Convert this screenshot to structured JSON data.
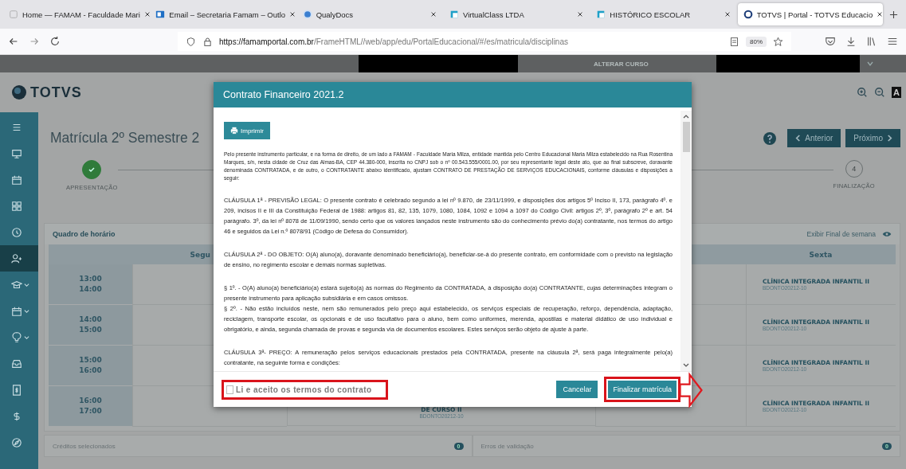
{
  "browser": {
    "tabs": [
      {
        "title": "Home — FAMAM - Faculdade Mari",
        "kind": "page",
        "selected": false
      },
      {
        "title": "Email – Secretaria Famam – Outlo",
        "kind": "mail",
        "selected": false
      },
      {
        "title": "QualyDocs",
        "kind": "globe",
        "selected": false
      },
      {
        "title": "VirtualClass LTDA",
        "kind": "square",
        "selected": false
      },
      {
        "title": "HISTÓRICO ESCOLAR",
        "kind": "square",
        "selected": false
      },
      {
        "title": "TOTVS | Portal - TOTVS Educacio",
        "kind": "ring",
        "selected": true
      }
    ],
    "url_host": "https://famamportal.com.br",
    "url_path": "/FrameHTML//web/app/edu/PortalEducacional/#/es/matricula/disciplinas",
    "zoom": "80%"
  },
  "top_bar": {
    "link": "ALTERAR CURSO"
  },
  "brand": {
    "logo": "TOTVS",
    "font_button": "A"
  },
  "sidebar": {
    "items": [
      {
        "kind": "menu",
        "selected": false,
        "expandable": false
      },
      {
        "kind": "monitor",
        "selected": false,
        "expandable": false
      },
      {
        "kind": "calendar",
        "selected": false,
        "expandable": false
      },
      {
        "kind": "grid",
        "selected": false,
        "expandable": false
      },
      {
        "kind": "clock",
        "selected": false,
        "expandable": false
      },
      {
        "kind": "person-add",
        "selected": true,
        "expandable": false
      },
      {
        "kind": "cap",
        "selected": false,
        "expandable": true
      },
      {
        "kind": "calendar",
        "selected": false,
        "expandable": true
      },
      {
        "kind": "bulb",
        "selected": false,
        "expandable": true
      },
      {
        "kind": "inbox",
        "selected": false,
        "expandable": false
      },
      {
        "kind": "document",
        "selected": false,
        "expandable": false
      },
      {
        "kind": "dollar",
        "selected": false,
        "expandable": false
      },
      {
        "kind": "compass",
        "selected": false,
        "expandable": false
      }
    ]
  },
  "page": {
    "title": "Matrícula 2º Semestre 2",
    "buttons": [
      {
        "label": "Anterior",
        "kind": "prev"
      },
      {
        "label": "Próximo",
        "kind": "next"
      }
    ]
  },
  "stepper": {
    "steps": [
      {
        "label": "APRESENTAÇÃO",
        "done": true
      },
      {
        "marker": "4",
        "label": "FINALIZAÇÃO",
        "done": false
      }
    ]
  },
  "schedule": {
    "title": "Quadro de horário",
    "weekend_toggle": "Exibir Final de semana",
    "monday_header": "Segu",
    "friday_header": "Sexta",
    "rows": [
      {
        "start": "13:00",
        "end": "14:00",
        "friday": {
          "name": "CLÍNICA INTEGRADA INFANTIL II",
          "code": "BDONTO20212-10"
        }
      },
      {
        "start": "14:00",
        "end": "15:00",
        "friday": {
          "name": "CLÍNICA INTEGRADA INFANTIL II",
          "code": "BDONTO20212-10"
        }
      },
      {
        "start": "15:00",
        "end": "16:00",
        "friday": {
          "name": "CLÍNICA INTEGRADA INFANTIL II",
          "code": "BDONTO20212-10"
        }
      },
      {
        "start": "16:00",
        "end": "17:00",
        "middle": {
          "name": "DE CURSO II",
          "code": "BDONTO20212-10"
        },
        "friday": {
          "name": "CLÍNICA INTEGRADA INFANTIL II",
          "code": "BDONTO20212-10"
        }
      }
    ]
  },
  "footer": {
    "credits_label": "Créditos selecionados",
    "credits_count": "0",
    "errors_label": "Erros de validação",
    "errors_count": "0"
  },
  "modal": {
    "title": "Contrato Financeiro 2021.2",
    "print_button": "Imprimir",
    "paragraphs": [
      {
        "kind": "preamble",
        "text": "Pelo presente instrumento particular, e na forma de direito, de um lado a FAMAM - Faculdade Maria Milza, entidade mantida pelo Centro Educacional Maria Milza estabelecido na Rua Rosentina Marques, s/n, nesta cidade de Cruz das Almas-BA, CEP 44.380-000, inscrita no CNPJ sob o nº 00.543.555/0001.00, por seu representante legal deste ato, que ao final subscreve, doravante denominada CONTRATADA, e de outro, o CONTRATANTE abaixo identificado, ajustam CONTRATO DE PRESTAÇÃO DE SERVIÇOS EDUCACIONAIS, conforme cláusulas e disposições a seguir:"
      },
      {
        "kind": "block",
        "text": "CLÁUSULA 1ª - PREVISÃO LEGAL: O presente contrato é celebrado segundo a lei nº 9.870, de 23/11/1999, e disposições dos artigos 5º Inciso II, 173, parágrafo 4º. e 209, incisos II e III da Constituição Federal de 1988: artigos 81, 82, 135, 1079, 1080, 1084, 1092 e 1094 a 1097 do Código Civil: artigos 2º, 3º, parágrafo 2º e art. 54 parágrafo. 3º, da lei nº 8078 de 11/09/1990, sendo certo que os valores lançados neste instrumento são do conhecimento prévio do(a) contratante, nos termos do artigo 46 e seguidos da Lei n.º 8078/91 (Código de Defesa do Consumidor)."
      },
      {
        "kind": "block",
        "text": "CLÁUSULA 2ª - DO OBJETO: O(A) aluno(a), doravante denominado beneficiário(a), beneficiar-se-á do presente contrato, em conformidade com o previsto na legislação de ensino, no regimento escolar e demais normas supletivas."
      },
      {
        "kind": "block",
        "text": "§ 1º. - O(A) aluno(a) beneficiário(a) estará sujeito(a) às normas do Regimento da CONTRATADA, à disposição do(a) CONTRATANTE, cujas determinações integram o presente instrumento para aplicação subsidiária e em casos omissos."
      },
      {
        "kind": "continuation",
        "text": "§ 2º. - Não estão incluídos neste, nem são remunerados pelo preço aqui estabelecido, os serviços especiais de recuperação, reforço, dependência, adaptação, reciclagem, transporte escolar, os opcionais e de uso facultativo para o aluno, bem como uniformes, merenda, apostilas e material didático de uso individual e obrigatório, e ainda, segunda chamada de provas e segunda via de documentos escolares. Estes serviços serão objeto de ajuste à parte."
      },
      {
        "kind": "block",
        "text": "CLÁUSULA 3ª- PREÇO: A remuneração pelos serviços educacionais prestados pela CONTRATADA, presente na cláusula 2ª, será paga integralmente pelo(a) contratante, na seguinte forma e condições:"
      }
    ],
    "accept": {
      "label": "Li e aceito os termos do contrato",
      "checked": false
    },
    "buttons": [
      {
        "label": "Cancelar",
        "kind": "cancel"
      },
      {
        "label": "Finalizar matrícula",
        "kind": "primary"
      }
    ]
  }
}
